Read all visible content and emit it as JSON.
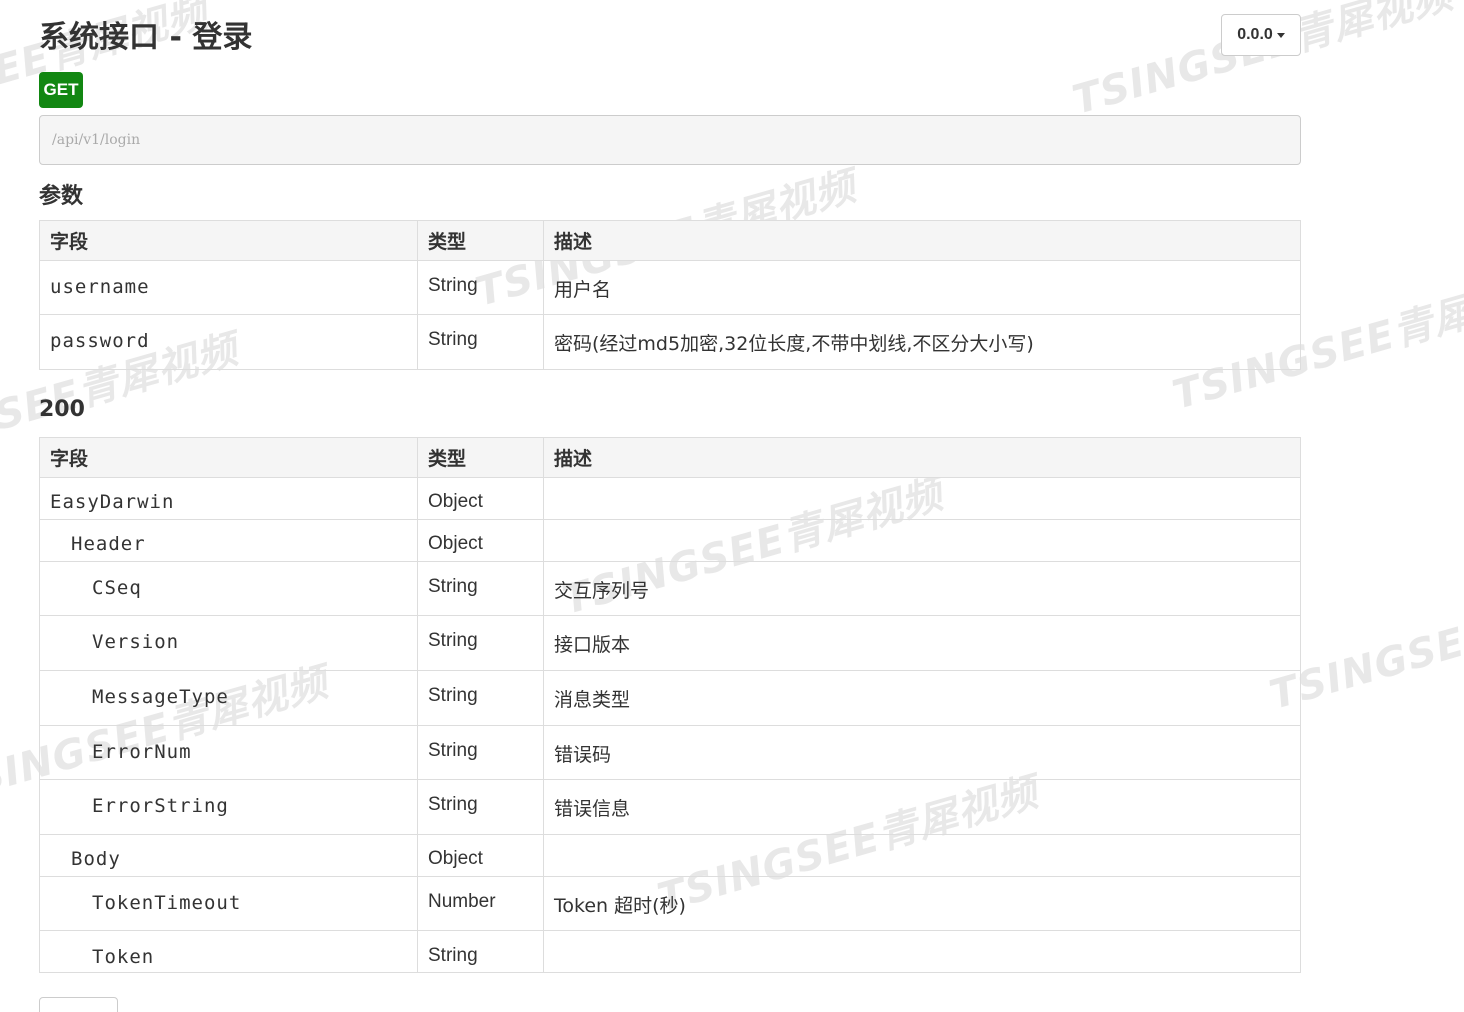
{
  "header": {
    "title": "系统接口 - 登录",
    "version_label": "0.0.0"
  },
  "request": {
    "method": "GET",
    "url": "/api/v1/login",
    "method_color": "#128712"
  },
  "params": {
    "title": "参数",
    "columns": [
      "字段",
      "类型",
      "描述"
    ],
    "rows": [
      {
        "field": "username",
        "type": "String",
        "desc": "用户名"
      },
      {
        "field": "password",
        "type": "String",
        "desc": "密码(经过md5加密,32位长度,不带中划线,不区分大小写)"
      }
    ]
  },
  "response": {
    "title": "200",
    "columns": [
      "字段",
      "类型",
      "描述"
    ],
    "rows": [
      {
        "field": "EasyDarwin",
        "type": "Object",
        "desc": "",
        "indent": 0
      },
      {
        "field": "Header",
        "type": "Object",
        "desc": "",
        "indent": 1
      },
      {
        "field": "CSeq",
        "type": "String",
        "desc": "交互序列号",
        "indent": 2
      },
      {
        "field": "Version",
        "type": "String",
        "desc": "接口版本",
        "indent": 2
      },
      {
        "field": "MessageType",
        "type": "String",
        "desc": "消息类型",
        "indent": 2
      },
      {
        "field": "ErrorNum",
        "type": "String",
        "desc": "错误码",
        "indent": 2
      },
      {
        "field": "ErrorString",
        "type": "String",
        "desc": "错误信息",
        "indent": 2
      },
      {
        "field": "Body",
        "type": "Object",
        "desc": "",
        "indent": 1
      },
      {
        "field": "TokenTimeout",
        "type": "Number",
        "desc": "Token 超时(秒)",
        "indent": 2
      },
      {
        "field": "Token",
        "type": "String",
        "desc": "",
        "indent": 2
      }
    ]
  },
  "watermarks": [
    "TSINGSEE青犀视频",
    "TSINGSEE青犀视频",
    "TSINGSEE青犀视频",
    "TSINGSEE青犀视频",
    "TSINGSEE青犀视频",
    "TSINGSEE青犀视频",
    "TSINGSEE青犀视频",
    "TSINGSEE青犀视频",
    "TSINGSEE青犀视频"
  ]
}
